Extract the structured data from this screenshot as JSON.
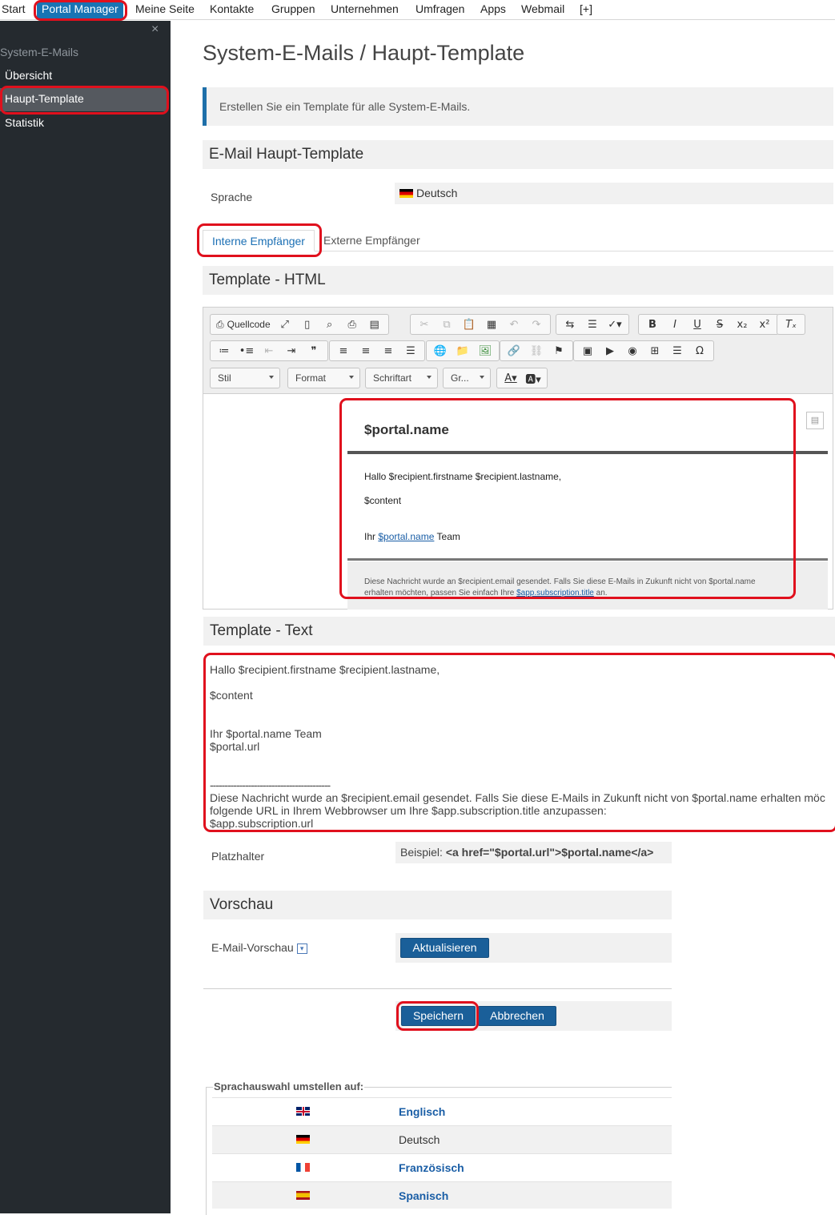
{
  "topnav": {
    "items": [
      "Start",
      "Portal Manager",
      "Meine Seite",
      "Kontakte",
      "Gruppen",
      "Unternehmen",
      "Umfragen",
      "Apps",
      "Webmail",
      "[+]"
    ]
  },
  "sidebar": {
    "close": "×",
    "section": "System-E-Mails",
    "items": [
      {
        "label": "Übersicht"
      },
      {
        "label": "Haupt-Template",
        "active": true
      },
      {
        "label": "Statistik"
      }
    ]
  },
  "page": {
    "title": "System-E-Mails / Haupt-Template",
    "info": "Erstellen Sie ein Template für alle System-E-Mails.",
    "section_main": "E-Mail Haupt-Template",
    "language_label": "Sprache",
    "language_value": "Deutsch",
    "tabs": [
      "Interne Empfänger",
      "Externe Empfänger"
    ],
    "section_html": "Template - HTML",
    "section_text": "Template - Text",
    "placeholder_label": "Platzhalter",
    "placeholder_prefix": "Beispiel:",
    "placeholder_example": "<a href=\"$portal.url\">$portal.name</a>",
    "section_preview": "Vorschau",
    "preview_label": "E-Mail-Vorschau",
    "refresh_button": "Aktualisieren",
    "save_button": "Speichern",
    "cancel_button": "Abbrechen"
  },
  "editor": {
    "source_button": "Quellcode",
    "combos": [
      "Stil",
      "Format",
      "Schriftart",
      "Gr..."
    ],
    "mail": {
      "title": "$portal.name",
      "greeting": "Hallo $recipient.firstname $recipient.lastname,",
      "content": "$content",
      "sign_prefix": "Ihr",
      "sign_link": "$portal.name",
      "sign_suffix": "Team",
      "footer_line1": "Diese Nachricht wurde an $recipient.email gesendet. Falls Sie diese E-Mails in Zukunft nicht von $portal.name",
      "footer_line2_prefix": "erhalten möchten, passen Sie einfach Ihre",
      "footer_link": "$app.subscription.title",
      "footer_line2_suffix": "an."
    }
  },
  "text_template": {
    "lines": [
      "Hallo $recipient.firstname $recipient.lastname,",
      "$content",
      "Ihr $portal.name Team",
      "$portal.url",
      "-----------------------------------------",
      "Diese Nachricht wurde an $recipient.email gesendet. Falls Sie diese E-Mails in Zukunft nicht von $portal.name erhalten möc",
      "folgende URL in Ihrem Webbrowser um  Ihre $app.subscription.title anzupassen:",
      "$app.subscription.url"
    ]
  },
  "language_switch": {
    "legend": "Sprachauswahl umstellen auf:",
    "items": [
      {
        "label": "Englisch",
        "flag": "flag-uk-icon"
      },
      {
        "label": "Deutsch",
        "flag": "flag-de-icon",
        "current": true
      },
      {
        "label": "Französisch",
        "flag": "flag-fr-icon"
      },
      {
        "label": "Spanisch",
        "flag": "flag-es-icon"
      }
    ]
  },
  "colors": {
    "accent": "#1874b4",
    "button": "#1a5f99",
    "highlight": "#e0101d",
    "sidebar": "#252a2f"
  }
}
